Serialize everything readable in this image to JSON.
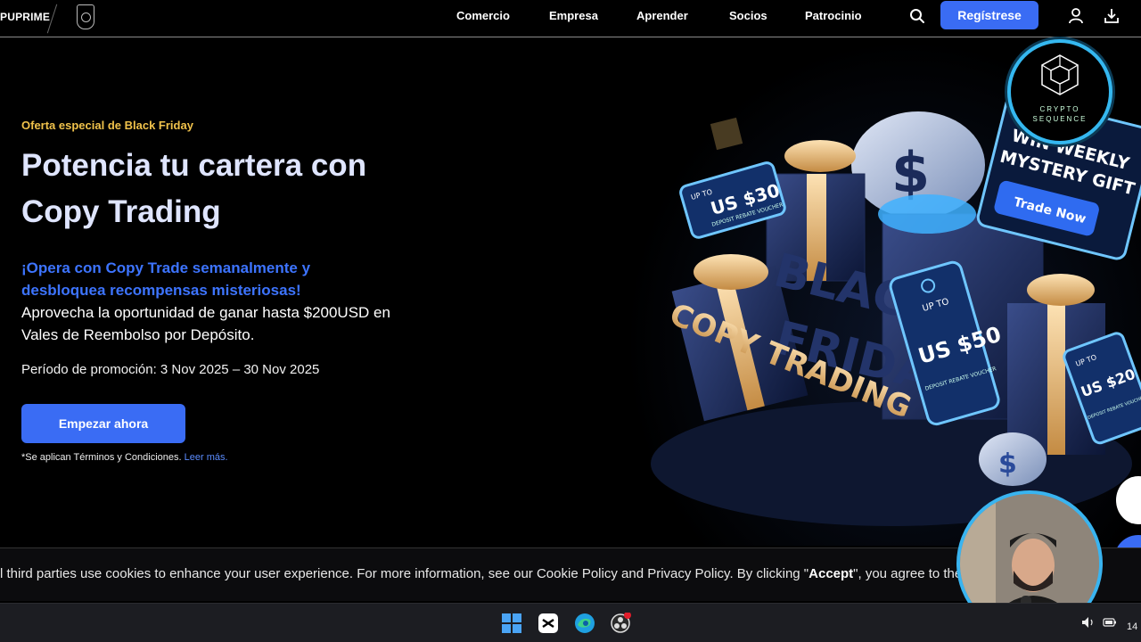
{
  "nav": {
    "logo": "PUPRIME",
    "links": [
      "Comercio",
      "Empresa",
      "Aprender",
      "Socios",
      "Patrocinio"
    ],
    "register_label": "Regístrese",
    "icons": [
      "search-icon",
      "user-icon",
      "download-icon"
    ]
  },
  "hero": {
    "eyebrow": "Oferta especial de Black Friday",
    "title": "Potencia tu cartera con Copy Trading",
    "blue_text": "¡Opera con Copy Trade semanalmente y desbloquea recompensas misteriosas!",
    "white_text": "Aprovecha la oportunidad de ganar hasta $200USD en Vales de Reembolso por Depósito.",
    "promo": "Período de promoción: 3 Nov 2025 – 30 Nov 2025",
    "cta_label": "Empezar ahora",
    "terms_text": "*Se aplican Términos y Condiciones.",
    "terms_link": "Leer más."
  },
  "art": {
    "tag_30_top": "UP TO",
    "tag_30_value": "US $30",
    "tag_30_sub": "DEPOSIT REBATE VOUCHER",
    "tag_50_top": "UP TO",
    "tag_50_value": "US $50",
    "tag_50_sub": "DEPOSIT REBATE VOUCHER",
    "tag_20_top": "UP TO",
    "tag_20_value": "US $20",
    "tag_20_sub": "DEPOSIT REBATE VOUCHER",
    "black_friday_1": "BLACK",
    "black_friday_2": "FRIDAY",
    "copy_trading": "COPY TRADING",
    "banner_line1": "WIN WEEKLY",
    "banner_line2": "MYSTERY GIFT",
    "banner_button": "Trade Now"
  },
  "overlay": {
    "badge_line1": "CRYPTO",
    "badge_line2": "SEQUENCE"
  },
  "cookie": {
    "text_before": "l third parties use cookies to enhance your user experience. For more information, see our Cookie Policy and Privacy Policy. By clicking \"",
    "accept_word": "Accept",
    "text_after": "\", you agree to the"
  },
  "taskbar": {
    "clock": "14"
  },
  "colors": {
    "accent": "#3a6cf4",
    "gold": "#f0c24b",
    "title": "#dfe5ff",
    "link_blue": "#3d74ff",
    "badge_ring": "#35b8f0"
  }
}
